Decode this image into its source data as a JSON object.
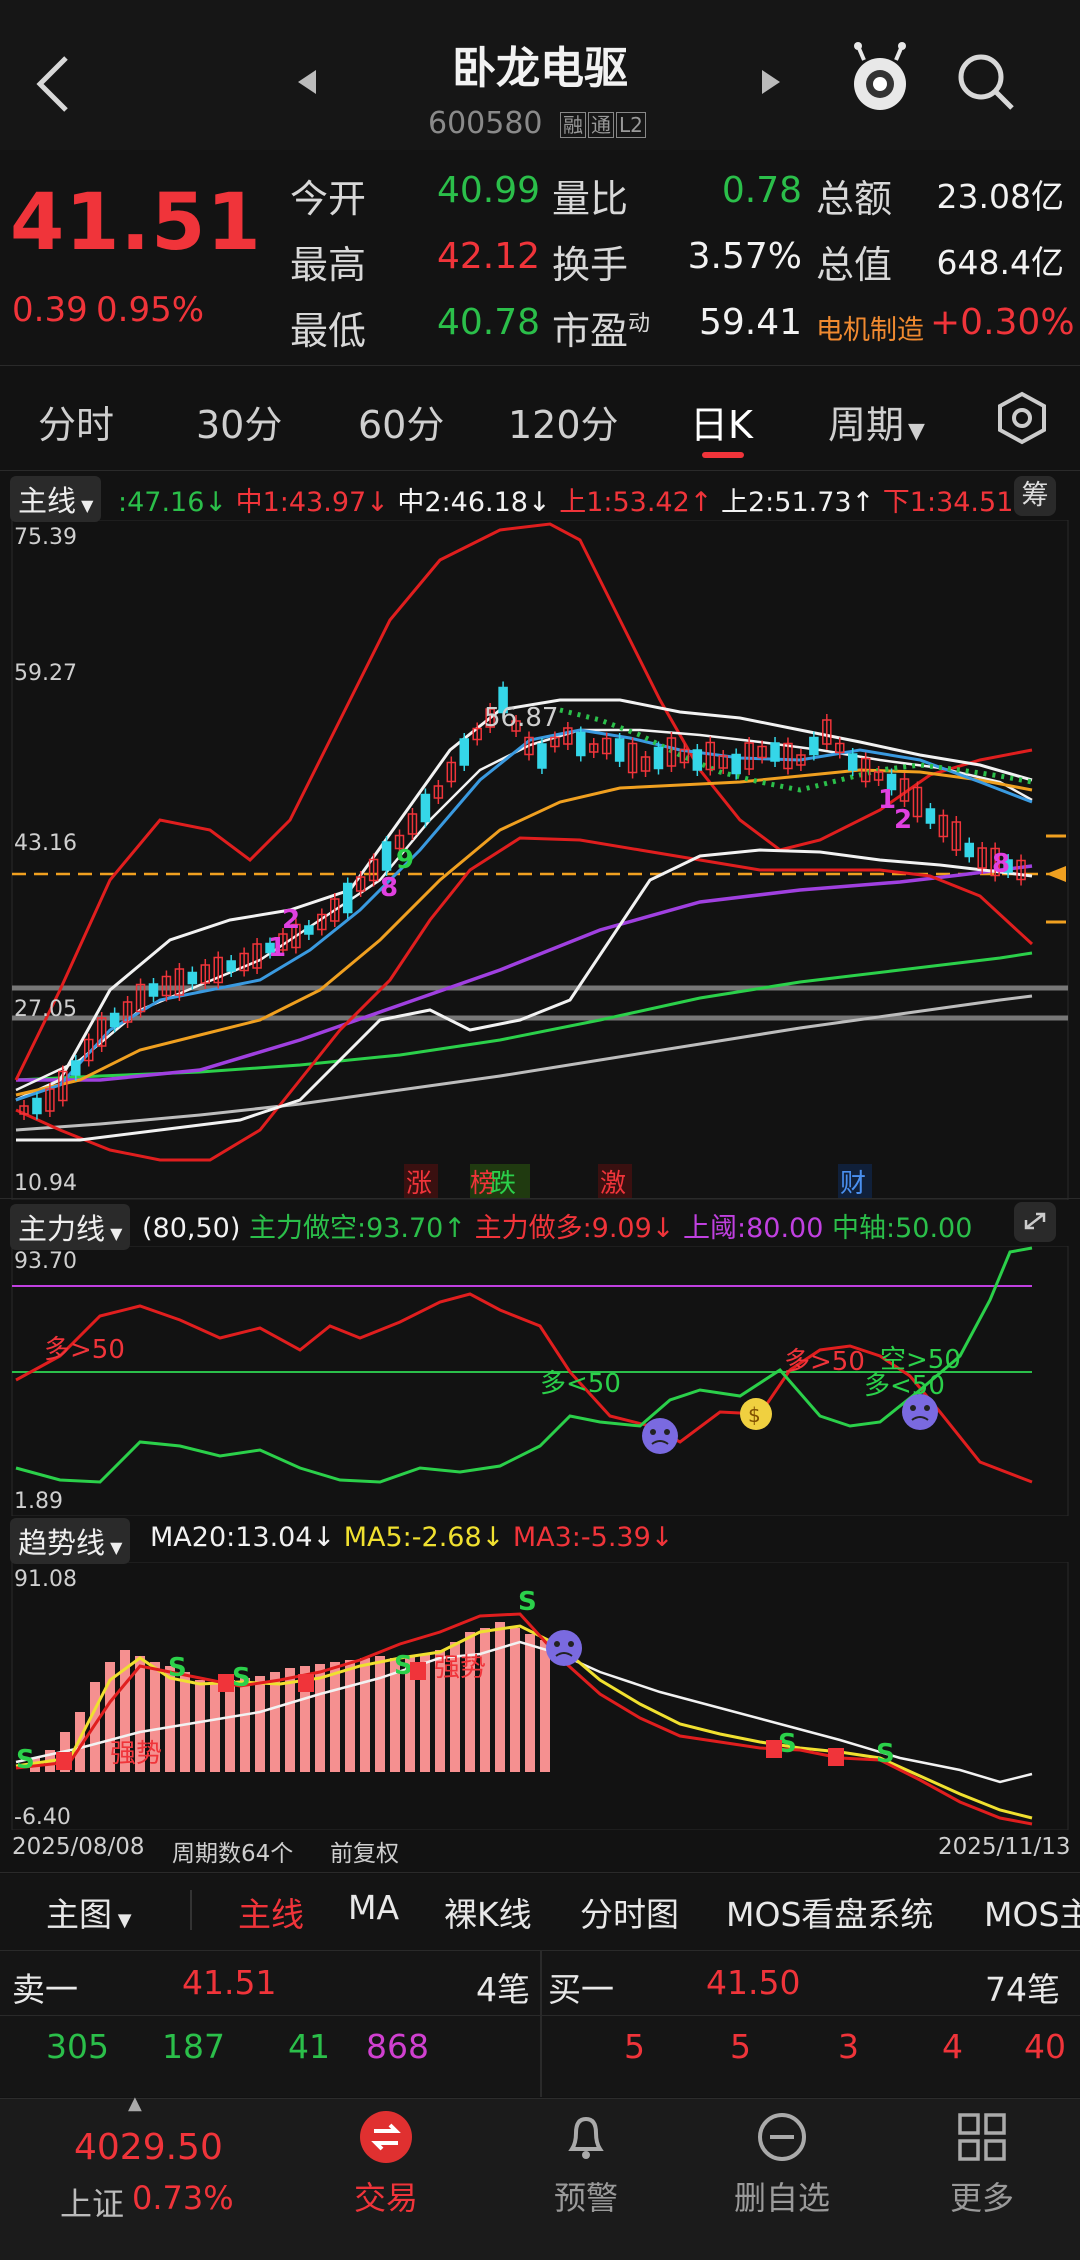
{
  "header": {
    "title": "卧龙电驱",
    "code": "600580",
    "badges": [
      "融",
      "通",
      "L2"
    ]
  },
  "quote": {
    "price": "41.51",
    "change": "0.39",
    "change_pct": "0.95%",
    "rows": [
      {
        "l1": "今开",
        "v1": "40.99",
        "l2": "量比",
        "v2": "0.78",
        "l3": "总额",
        "v3": "23.08亿"
      },
      {
        "l1": "最高",
        "v1": "42.12",
        "l2": "换手",
        "v2": "3.57%",
        "l3": "总值",
        "v3": "648.4亿"
      },
      {
        "l1": "最低",
        "v1": "40.78",
        "l2": "市盈",
        "l2sup": "动",
        "v2": "59.41",
        "l3": "电机制造",
        "v3": "+0.30%"
      }
    ]
  },
  "periods": {
    "items": [
      "分时",
      "30分",
      "60分",
      "120分",
      "日K",
      "周期"
    ],
    "active": "日K"
  },
  "main_chart": {
    "label": "主线",
    "legend": [
      {
        "text": ":47.16↓",
        "color": "#2bbf4a"
      },
      {
        "text": "中1:43.97↓",
        "color": "#f0343a"
      },
      {
        "text": "中2:46.18↓",
        "color": "#f2f2f2"
      },
      {
        "text": "上1:53.42↑",
        "color": "#f0343a"
      },
      {
        "text": "上2:51.73↑",
        "color": "#f2f2f2"
      },
      {
        "text": "下1:34.51↓",
        "color": "#f0343a"
      }
    ],
    "chip_label": "筹",
    "y_ticks": [
      "75.39",
      "59.27",
      "43.16",
      "27.05",
      "10.94"
    ],
    "peak_label": "56.87",
    "event_tags": [
      "涨",
      "榜",
      "跌",
      "激",
      "财"
    ],
    "markers": [
      "9",
      "8",
      "2",
      "1",
      "1",
      "2",
      "8"
    ]
  },
  "main_force": {
    "label": "主力线",
    "params": "(80,50)",
    "legend": [
      {
        "text": "主力做空:93.70↑",
        "color": "#2bbf4a"
      },
      {
        "text": "主力做多:9.09↓",
        "color": "#f0343a"
      },
      {
        "text": "上阈:80.00",
        "color": "#c040e0"
      },
      {
        "text": "中轴:50.00",
        "color": "#2bbf4a"
      }
    ],
    "y_top": "93.70",
    "y_bottom": "1.89",
    "annotations": [
      "多>50",
      "多<50",
      "多>50",
      "空>50",
      "多<50"
    ]
  },
  "trend": {
    "label": "趋势线",
    "legend": [
      {
        "text": "MA20:13.04↓",
        "color": "#f2f2f2"
      },
      {
        "text": "MA5:-2.68↓",
        "color": "#f0e030"
      },
      {
        "text": "MA3:-5.39↓",
        "color": "#f0343a"
      }
    ],
    "y_top": "91.08",
    "y_bottom": "-6.40",
    "strong_label": "强势"
  },
  "footer_info": {
    "start_date": "2025/08/08",
    "period_count": "周期数64个",
    "adjust": "前复权",
    "end_date": "2025/11/13"
  },
  "indicator_tabs": {
    "first": "主图",
    "items": [
      "主线",
      "MA",
      "裸K线",
      "分时图",
      "MOS看盘系统",
      "MOS主"
    ],
    "active": "主线"
  },
  "orderbook": {
    "sell_label": "卖一",
    "sell_price": "41.51",
    "sell_count": "4笔",
    "buy_label": "买一",
    "buy_price": "41.50",
    "buy_count": "74笔",
    "left_values": [
      {
        "v": "305",
        "color": "#2bbf4a"
      },
      {
        "v": "187",
        "color": "#2bbf4a"
      },
      {
        "v": "41",
        "color": "#2bbf4a"
      },
      {
        "v": "868",
        "color": "#d040d0"
      }
    ],
    "right_values": [
      "5",
      "5",
      "3",
      "4",
      "40"
    ]
  },
  "bottom_nav": {
    "index_value": "4029.50",
    "index_name": "上证",
    "index_pct": "0.73%",
    "items": [
      {
        "label": "交易",
        "active": true
      },
      {
        "label": "预警",
        "active": false
      },
      {
        "label": "删自选",
        "active": false
      },
      {
        "label": "更多",
        "active": false
      }
    ]
  }
}
